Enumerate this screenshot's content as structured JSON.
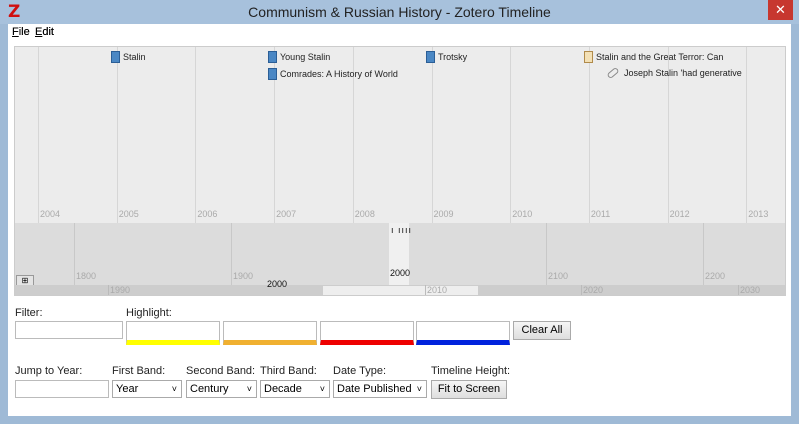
{
  "window": {
    "title": "Communism & Russian History - Zotero Timeline",
    "logo": "Z",
    "close": "✕"
  },
  "menu": [
    {
      "label": "File",
      "key": "F",
      "rest": "ile"
    },
    {
      "label": "Edit",
      "key": "E",
      "rest": "dit"
    }
  ],
  "timeline": {
    "band1_years": [
      "2004",
      "2005",
      "2006",
      "2007",
      "2008",
      "2009",
      "2010",
      "2011",
      "2012",
      "2013"
    ],
    "band2_centuries": [
      "1800",
      "1900",
      "2100",
      "2200"
    ],
    "band2_current": "2000",
    "band3_decades": [
      "1990",
      "2010",
      "2020",
      "2030"
    ],
    "band3_current": "2000",
    "events": [
      {
        "title": "Stalin",
        "icon": "book-icon"
      },
      {
        "title": "Young Stalin",
        "icon": "book-icon"
      },
      {
        "title": "Comrades: A History of World",
        "icon": "book-icon"
      },
      {
        "title": "Trotsky",
        "icon": "book-icon"
      },
      {
        "title": "Stalin and the Great Terror: Can",
        "icon": "document-icon"
      },
      {
        "title": "Joseph Stalin 'had generative",
        "icon": "attachment-icon"
      }
    ]
  },
  "controls": {
    "filter_label": "Filter:",
    "filter_value": "",
    "highlight_label": "Highlight:",
    "highlight_colors": [
      "#ffff00",
      "#f0b030",
      "#ee0000",
      "#0022dd"
    ],
    "clear_all": "Clear All",
    "jump_label": "Jump to Year:",
    "jump_value": "",
    "first_band_label": "First Band:",
    "first_band": "Year",
    "second_band_label": "Second Band:",
    "second_band": "Century",
    "third_band_label": "Third Band:",
    "third_band": "Decade",
    "date_type_label": "Date Type:",
    "date_type": "Date Published",
    "height_label": "Timeline Height:",
    "fit": "Fit to Screen"
  }
}
